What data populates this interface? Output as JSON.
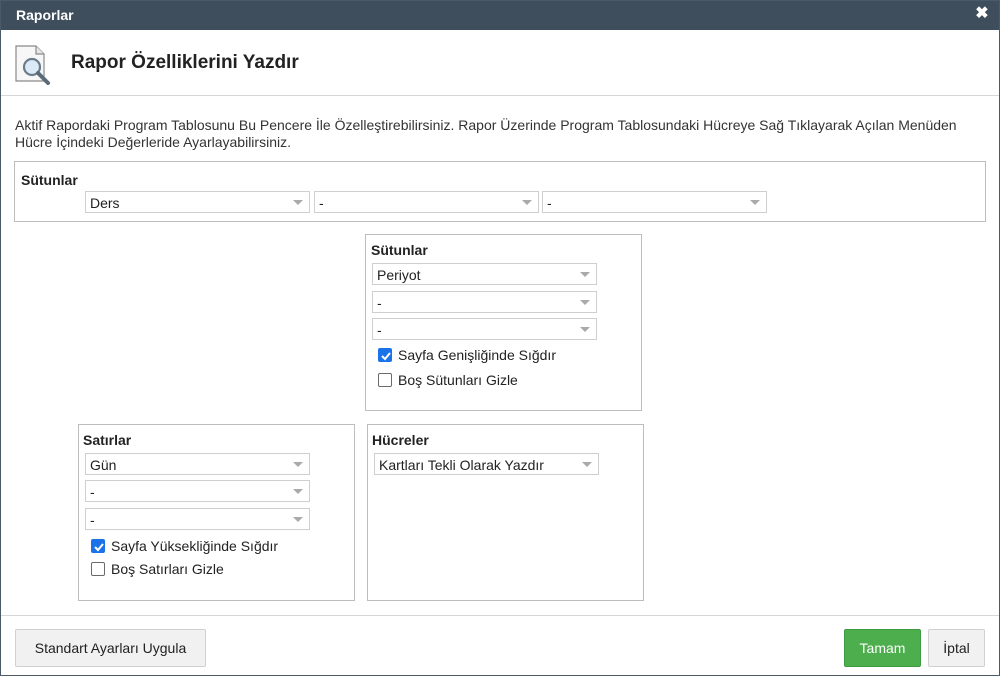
{
  "window": {
    "title": "Raporlar"
  },
  "header": {
    "title": "Rapor Özelliklerini Yazdır"
  },
  "description": "Aktif Rapordaki Program Tablosunu Bu Pencere İle Özelleştirebilirsiniz. Rapor Üzerinde Program Tablosundaki Hücreye Sağ Tıklayarak Açılan Menüden Hücre İçindeki Değerleride Ayarlayabilirsiniz.",
  "top_columns": {
    "label": "Sütunlar",
    "selects": [
      "Ders",
      "-",
      "-"
    ]
  },
  "columns": {
    "label": "Sütunlar",
    "selects": [
      "Periyot",
      "-",
      "-"
    ],
    "checkboxes": [
      {
        "label": "Sayfa Genişliğinde Sığdır",
        "checked": true
      },
      {
        "label": "Boş Sütunları Gizle",
        "checked": false
      }
    ]
  },
  "rows": {
    "label": "Satırlar",
    "selects": [
      "Gün",
      "-",
      "-"
    ],
    "checkboxes": [
      {
        "label": "Sayfa Yüksekliğinde Sığdır",
        "checked": true
      },
      {
        "label": "Boş Satırları Gizle",
        "checked": false
      }
    ]
  },
  "cells": {
    "label": "Hücreler",
    "select": "Kartları Tekli Olarak Yazdır"
  },
  "footer": {
    "apply_defaults_label": "Standart Ayarları Uygula",
    "ok_label": "Tamam",
    "cancel_label": "İptal"
  },
  "colors": {
    "titlebar": "#3e4e5c",
    "primary_button": "#4cae4c",
    "checkbox_checked": "#1a73e8"
  },
  "icons": {
    "close": "close-icon",
    "report": "report-search-icon",
    "dropdown": "chevron-down-icon",
    "check": "check-icon"
  }
}
